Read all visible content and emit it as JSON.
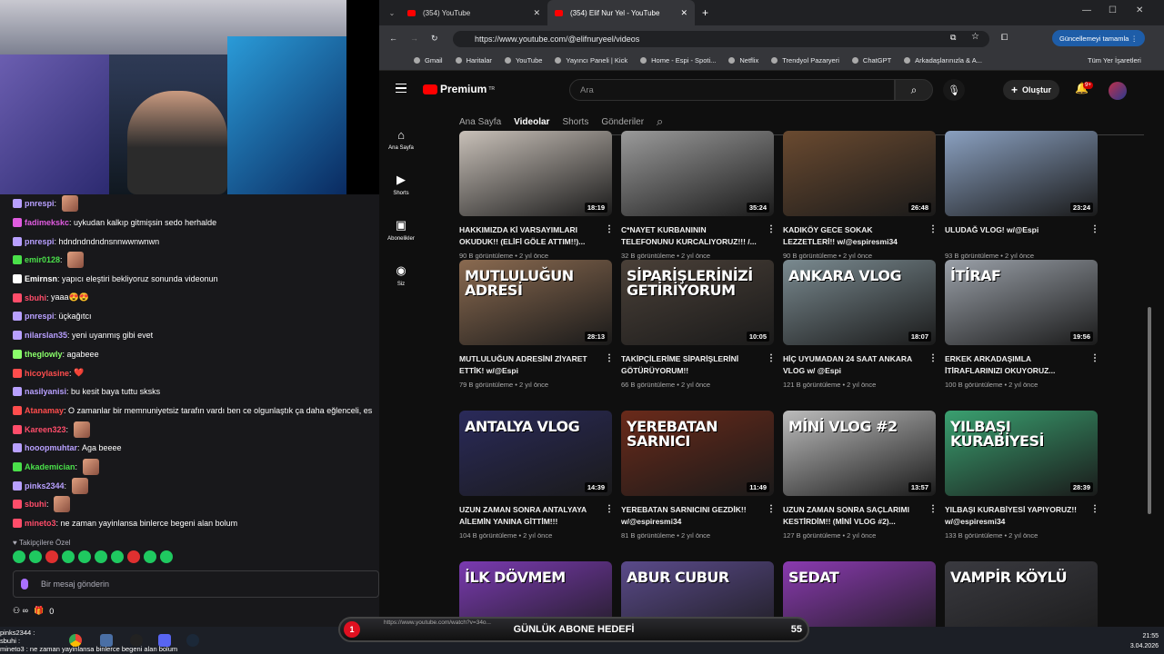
{
  "chat": {
    "messages": [
      {
        "user": "pnrespi",
        "color": "#b8a0ff",
        "text": "",
        "emote": true
      },
      {
        "user": "fadimekskc",
        "color": "#e05ce0",
        "text": "uykudan kalkıp gitmişsin sedo herhalde",
        "emote": false
      },
      {
        "user": "pnrespi",
        "color": "#b8a0ff",
        "text": "hdndndndndnsnnwwnwnwn",
        "emote": false
      },
      {
        "user": "emir0128",
        "color": "#4ae04a",
        "text": "",
        "emote": true
      },
      {
        "user": "Emirnsn",
        "color": "#ffffff",
        "text": "yapıcı eleştiri bekliyoruz sonunda videonun",
        "emote": false
      },
      {
        "user": "sbuhi",
        "color": "#ff4d6a",
        "text": "yaaa😍😍",
        "emote": false
      },
      {
        "user": "pnrespi",
        "color": "#b8a0ff",
        "text": "üçkağıtcı",
        "emote": false
      },
      {
        "user": "nilarslan35",
        "color": "#b8a0ff",
        "text": "yeni uyanmış gibi evet",
        "emote": false
      },
      {
        "user": "theglowly",
        "color": "#8aff6a",
        "text": "agabeee",
        "emote": false
      },
      {
        "user": "hicoylasine",
        "color": "#ff4d4d",
        "text": "❤️",
        "emote": false
      },
      {
        "user": "nasilyanisi",
        "color": "#b8a0ff",
        "text": "bu kesit baya tuttu sksks",
        "emote": false
      },
      {
        "user": "Atanamay",
        "color": "#ff4d4d",
        "text": "O zamanlar bir memnuniyetsiz tarafın vardı ben ce olgunlaştık ça daha eğlenceli, es",
        "emote": false
      },
      {
        "user": "Kareen323",
        "color": "#ff4d6a",
        "text": "",
        "emote": true
      },
      {
        "user": "hooopmuhtar",
        "color": "#b8a0ff",
        "text": "Aga beeee",
        "emote": false
      },
      {
        "user": "Akademician",
        "color": "#4ae04a",
        "text": "",
        "emote": true
      },
      {
        "user": "pinks2344",
        "color": "#b8a0ff",
        "text": "",
        "emote": true
      },
      {
        "user": "sbuhi",
        "color": "#ff4d6a",
        "text": "",
        "emote": true
      },
      {
        "user": "mineto3",
        "color": "#ff4d6a",
        "text": "ne zaman yayinlansa binlerce begeni alan bolum",
        "emote": false
      }
    ],
    "follower_only": "Takipçilere Özel",
    "input_placeholder": "Bir mesaj gönderin",
    "viewer_count": "0"
  },
  "browser": {
    "tabs": [
      {
        "title": "(354) YouTube"
      },
      {
        "title": "(354) Elif Nur Yel - YouTube"
      }
    ],
    "new_tab": "+",
    "url": "https://www.youtube.com/@elifnuryeel/videos",
    "update_button": "Güncellemeyi tamamla",
    "bookmarks": [
      "Gmail",
      "Haritalar",
      "YouTube",
      "Yayıncı Paneli | Kick",
      "Home - Espi - Spoti...",
      "Netflix",
      "Trendyol Pazaryeri",
      "ChatGPT",
      "Arkadaşlarınızla & A..."
    ],
    "all_bookmarks": "Tüm Yer İşaretleri"
  },
  "youtube": {
    "logo": "Premium",
    "logo_sup": "TR",
    "search_placeholder": "Ara",
    "create_label": "Oluştur",
    "notif_badge": "9+",
    "sidebar": [
      {
        "label": "Ana Sayfa",
        "icon": "home-icon"
      },
      {
        "label": "Shorts",
        "icon": "shorts-icon"
      },
      {
        "label": "Abonelikler",
        "icon": "subscriptions-icon"
      },
      {
        "label": "Siz",
        "icon": "you-icon"
      }
    ],
    "channel_tabs": [
      "Ana Sayfa",
      "Videolar",
      "Shorts",
      "Gönderiler"
    ],
    "active_tab": "Videolar",
    "videos": [
      {
        "thumb_text": "",
        "title": "HAKKIMIZDA Kİ VARSAYIMLARI OKUDUK!! (ELİFİ GÖLE ATTIM!!)...",
        "meta": "90 B görüntüleme • 2 yıl önce",
        "dur": "18:19",
        "bg": "#c8c0b8"
      },
      {
        "thumb_text": "",
        "title": "C*NAYET KURBANININ TELEFONUNU KURCALIYORUZ!!! /...",
        "meta": "32 B görüntüleme • 2 yıl önce",
        "dur": "35:24",
        "bg": "#9a9a9a"
      },
      {
        "thumb_text": "",
        "title": "KADIKÖY GECE SOKAK LEZZETLERİ!! w/@espiresmi34",
        "meta": "90 B görüntüleme • 2 yıl önce",
        "dur": "26:48",
        "bg": "#6a4a30"
      },
      {
        "thumb_text": "",
        "title": "ULUDAĞ VLOG! w/@Espi",
        "meta": "93 B görüntüleme • 2 yıl önce",
        "dur": "23:24",
        "bg": "#8aa0c0"
      },
      {
        "thumb_text": "MUTLULUĞUN ADRESİ",
        "title": "MUTLULUĞUN ADRESİNİ ZİYARET ETTİK! w/@Espi",
        "meta": "79 B görüntüleme • 2 yıl önce",
        "dur": "28:13",
        "bg": "#8a6a50"
      },
      {
        "thumb_text": "SİPARİŞLERİNİZİ GETİRİYORUM",
        "title": "TAKİPÇİLERİME SİPARİŞLERİNİ GÖTÜRÜYORUM!!",
        "meta": "66 B görüntüleme • 2 yıl önce",
        "dur": "10:05",
        "bg": "#4a4038"
      },
      {
        "thumb_text": "ANKARA VLOG",
        "title": "HİÇ UYUMADAN 24 SAAT ANKARA VLOG w/ @Espi",
        "meta": "121 B görüntüleme • 2 yıl önce",
        "dur": "18:07",
        "bg": "#7a8a90"
      },
      {
        "thumb_text": "İTİRAF",
        "title": "ERKEK ARKADAŞIMLA İTİRAFLARINIZI OKUYORUZ...",
        "meta": "100 B görüntüleme • 2 yıl önce",
        "dur": "19:56",
        "bg": "#9aa0a8"
      },
      {
        "thumb_text": "ANTALYA VLOG",
        "title": "UZUN ZAMAN SONRA ANTALYAYA AİLEMİN YANINA GİTTİM!!!",
        "meta": "104 B görüntüleme • 2 yıl önce",
        "dur": "14:39",
        "bg": "#2a2a5a"
      },
      {
        "thumb_text": "YEREBATAN SARNICI",
        "title": "YEREBATAN SARNICINI GEZDİK!! w/@espiresmi34",
        "meta": "81 B görüntüleme • 2 yıl önce",
        "dur": "11:49",
        "bg": "#6a2a1a"
      },
      {
        "thumb_text": "MİNİ VLOG #2",
        "title": "UZUN ZAMAN SONRA SAÇLARIMI KESTİRDİM!! (MİNİ VLOG #2)...",
        "meta": "127 B görüntüleme • 2 yıl önce",
        "dur": "13:57",
        "bg": "#bcbcbc"
      },
      {
        "thumb_text": "YILBAŞI KURABİYESİ",
        "title": "YILBAŞI KURABİYESİ YAPIYORUZ!! w/@espiresmi34",
        "meta": "133 B görüntüleme • 2 yıl önce",
        "dur": "28:39",
        "bg": "#3aa070"
      },
      {
        "thumb_text": "İLK DÖVMEM",
        "title": "",
        "meta": "",
        "dur": "",
        "bg": "#7a3ab0"
      },
      {
        "thumb_text": "ABUR CUBUR",
        "title": "",
        "meta": "",
        "dur": "",
        "bg": "#5a4a8a"
      },
      {
        "thumb_text": "SEDAT",
        "title": "",
        "meta": "",
        "dur": "",
        "bg": "#8a3ab0"
      },
      {
        "thumb_text": "VAMPİR KÖYLÜ",
        "title": "",
        "meta": "",
        "dur": "",
        "bg": "#3a3a40"
      }
    ]
  },
  "overlay": {
    "goal_label": "GÜNLÜK ABONE HEDEFİ",
    "goal_current": "1",
    "goal_target": "55",
    "hover_link": "https://www.youtube.com/watch?v=34o..."
  },
  "taskbar": {
    "chat_line_1": "pinks2344 :",
    "chat_line_2": "sbuhi :",
    "chat_line_3": "mineto3 : ne zaman yayinlansa binlerce begeni alan bolum",
    "time": "21:55",
    "date": "3.04.2026"
  }
}
